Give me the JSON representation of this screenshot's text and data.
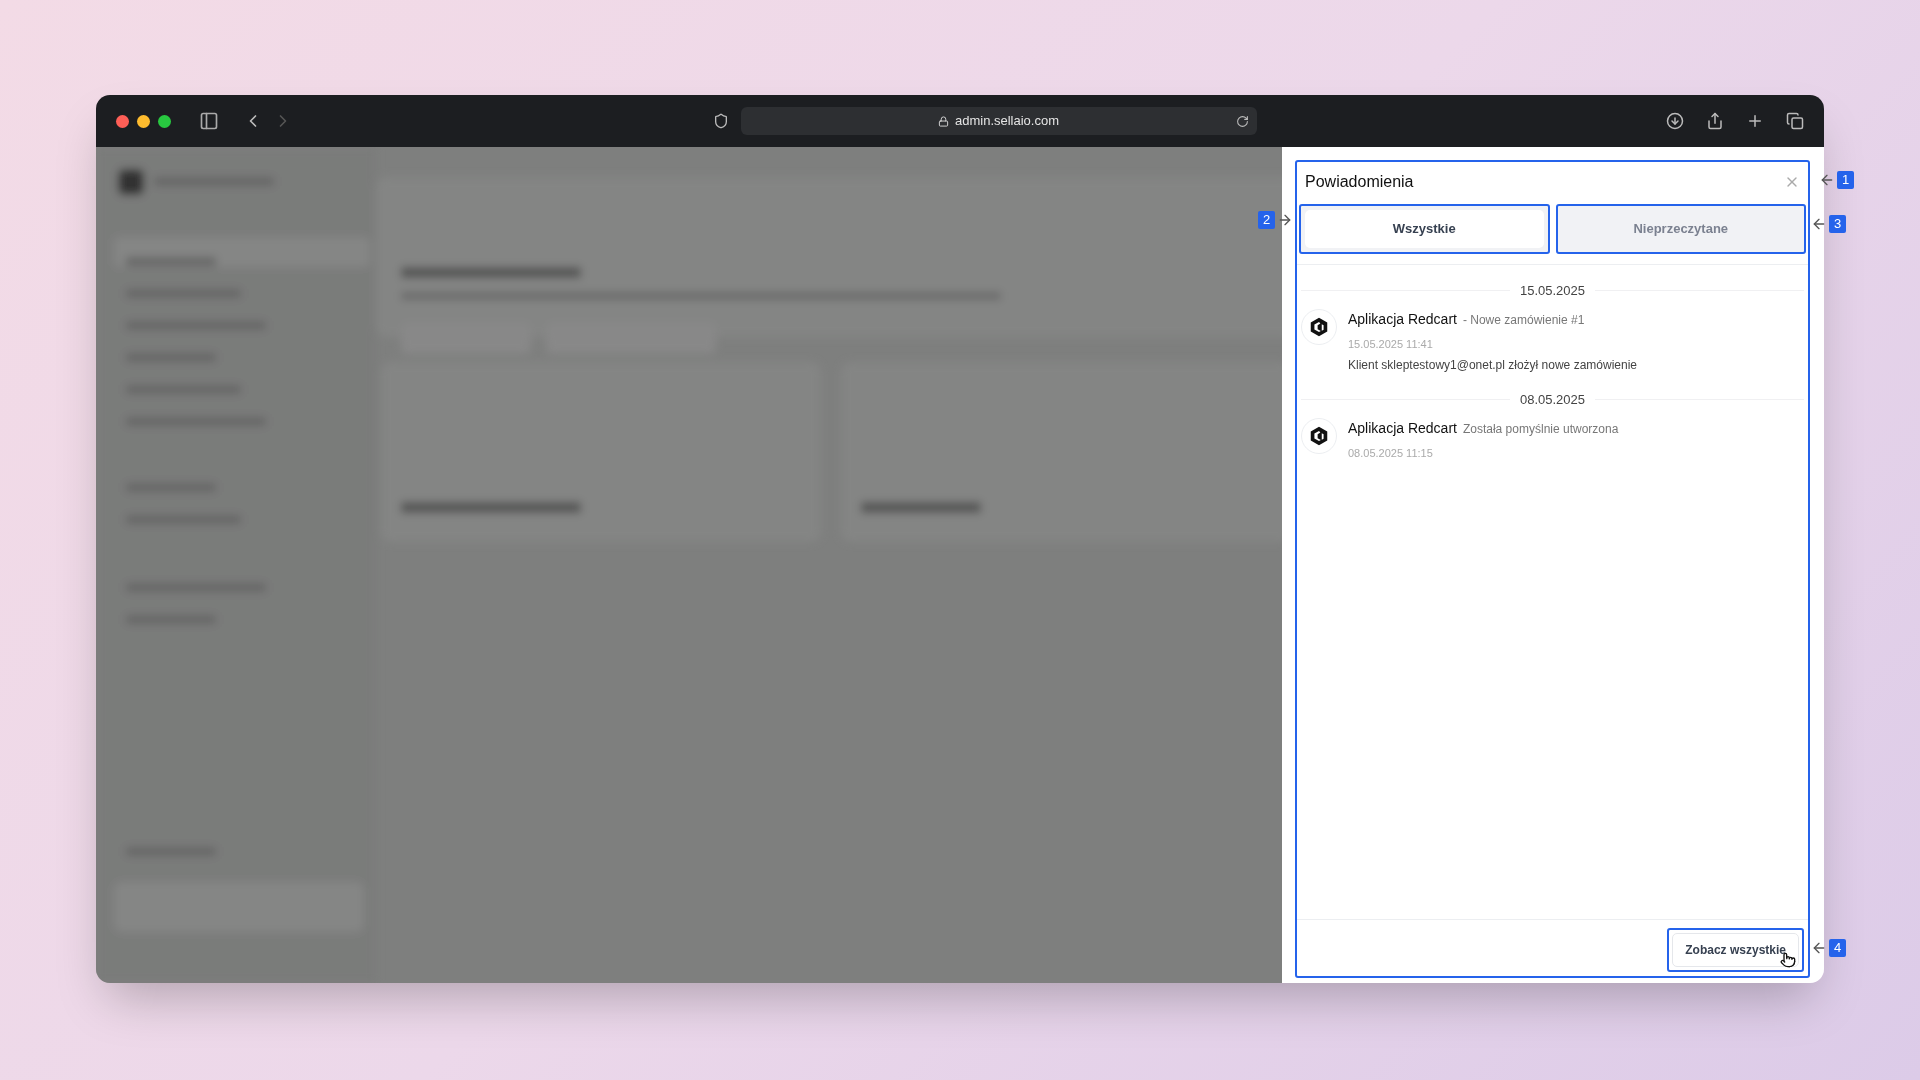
{
  "browser": {
    "url": "admin.sellaio.com"
  },
  "panel": {
    "title": "Powiadomienia",
    "tabs": [
      {
        "label": "Wszystkie",
        "selected": true
      },
      {
        "label": "Nieprzeczytane",
        "selected": false
      }
    ],
    "groups": [
      {
        "date": "15.05.2025",
        "items": [
          {
            "sender": "Aplikacja Redcart",
            "subject": "- Nowe zamówienie #1",
            "time": "15.05.2025 11:41",
            "body": "Klient skleptestowy1@onet.pl złożył nowe zamówienie"
          }
        ]
      },
      {
        "date": "08.05.2025",
        "items": [
          {
            "sender": "Aplikacja Redcart",
            "subject": "Została pomyślnie utworzona",
            "time": "08.05.2025 11:15"
          }
        ]
      }
    ],
    "footer_button": "Zobacz wszystkie"
  },
  "annotations": [
    {
      "label": "1"
    },
    {
      "label": "2"
    },
    {
      "label": "3"
    },
    {
      "label": "4"
    }
  ]
}
